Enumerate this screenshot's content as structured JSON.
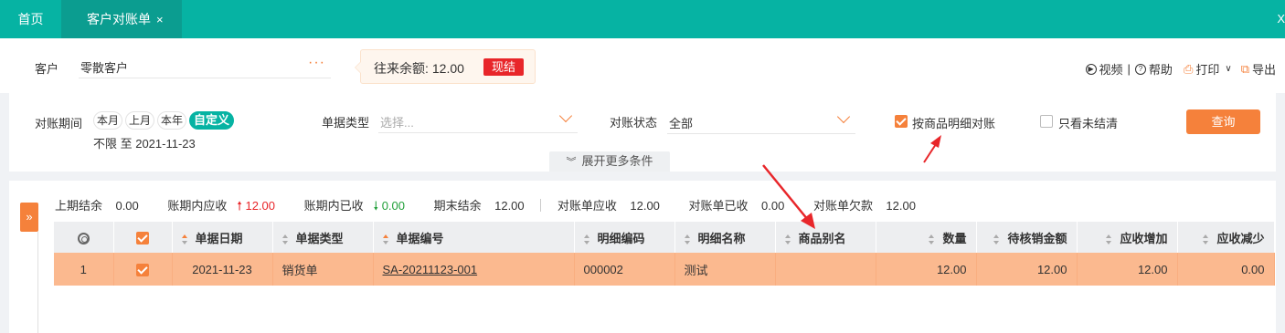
{
  "tabs": {
    "home_label": "首页",
    "active_label": "客户对账单",
    "close_glyph": "×",
    "right_close_glyph": "X"
  },
  "customer": {
    "label": "客户",
    "value": "零散客户",
    "picker_glyph": "···",
    "balance_label": "往来余额:",
    "balance_value": "12.00",
    "settle_label": "现结"
  },
  "toolbar": {
    "video_label": "视频",
    "separator": "|",
    "help_label": "帮助",
    "print_label": "打印",
    "export_label": "导出"
  },
  "filter": {
    "period_label": "对账期间",
    "period_options": [
      "本月",
      "上月",
      "本年",
      "自定义"
    ],
    "period_active_index": 3,
    "date_range": "不限 至 2021-11-23",
    "doc_type_label": "单据类型",
    "doc_type_placeholder": "选择...",
    "status_label": "对账状态",
    "status_value": "全部",
    "by_product_label": "按商品明细对账",
    "by_product_checked": true,
    "unsettled_label": "只看未结清",
    "unsettled_checked": false,
    "query_label": "查询",
    "expand_label": "展开更多条件"
  },
  "summary": {
    "items": [
      {
        "label": "上期结余",
        "value": "0.00"
      },
      {
        "label": "账期内应收",
        "value": "12.00"
      },
      {
        "label": "账期内已收",
        "value": "0.00"
      },
      {
        "label": "期末结余",
        "value": "12.00"
      },
      {
        "label": "对账单应收",
        "value": "12.00"
      },
      {
        "label": "对账单已收",
        "value": "0.00"
      },
      {
        "label": "对账单欠款",
        "value": "12.00"
      }
    ]
  },
  "table": {
    "columns": [
      "单据日期",
      "单据类型",
      "单据编号",
      "明细编码",
      "明细名称",
      "商品别名",
      "数量",
      "待核销金额",
      "应收增加",
      "应收减少"
    ],
    "rows": [
      {
        "index": "1",
        "date": "2021-11-23",
        "type": "销货单",
        "number": "SA-20211123-001",
        "detail_code": "000002",
        "detail_name": "测试",
        "alias": "",
        "qty": "12.00",
        "pending": "12.00",
        "increase": "12.00",
        "decrease": "0.00"
      }
    ]
  },
  "colors": {
    "teal": "#06b3a3",
    "orange": "#f5813b",
    "row_highlight": "#fbb98f",
    "red": "#e8262a",
    "green": "#22a03a"
  }
}
